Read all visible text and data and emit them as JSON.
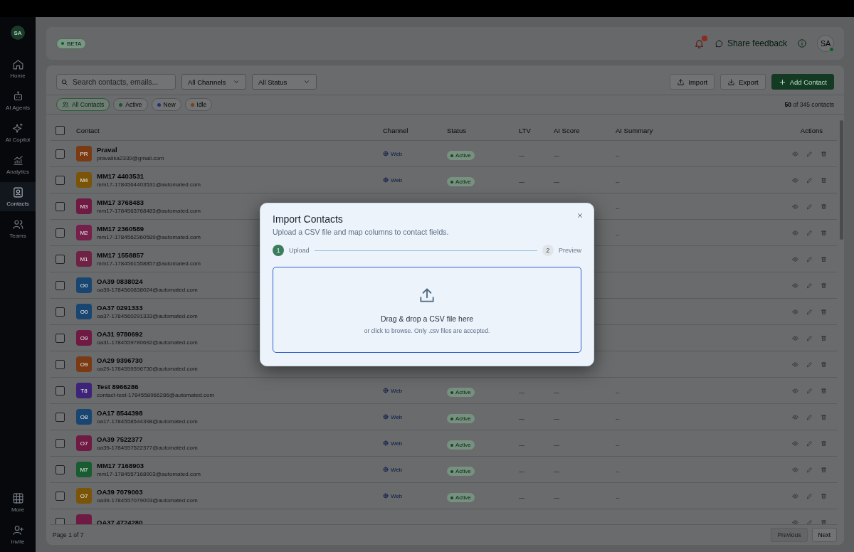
{
  "sidebar": {
    "avatar": "SA",
    "items": [
      {
        "label": "Home",
        "selected": false
      },
      {
        "label": "AI Agents",
        "selected": false
      },
      {
        "label": "AI Copilot",
        "selected": false
      },
      {
        "label": "Analytics",
        "selected": false
      },
      {
        "label": "Contacts",
        "selected": true
      },
      {
        "label": "Teams",
        "selected": false
      }
    ],
    "bottom_items": [
      {
        "label": "More"
      },
      {
        "label": "Invite"
      }
    ]
  },
  "header": {
    "badge": "BETA",
    "feedback": "Share feedback",
    "avatar": "SA"
  },
  "toolbar": {
    "search": {
      "placeholder": "Search contacts, emails..."
    },
    "filters": [
      "All Channels",
      "All Status"
    ],
    "buttons": [
      {
        "label": "Import",
        "kind": "import"
      },
      {
        "label": "Export",
        "kind": "export"
      },
      {
        "label": "Add Contact",
        "kind": "add"
      }
    ]
  },
  "chips": [
    {
      "label": "All Contacts",
      "kind": "all",
      "selected": true
    },
    {
      "label": "Active",
      "kind": "status",
      "color": "#0f5a28",
      "selected": false
    },
    {
      "label": "New",
      "kind": "status",
      "color": "#26307a",
      "selected": false
    },
    {
      "label": "Idle",
      "kind": "status",
      "color": "#7a4212",
      "selected": false
    }
  ],
  "count": "**50** of 345 contacts",
  "table": {
    "columns": [
      "Contact",
      "Channel",
      "Status",
      "LTV",
      "AI Score",
      "AI Summary",
      "Actions"
    ],
    "select_all_checked": false,
    "rows": [
      {
        "initials": "PR",
        "color": "#7a3a14",
        "name": "Praval",
        "email": "pravalika2330@gmail.com",
        "channel": "Web",
        "status": "Active",
        "ltv": "—",
        "score": "—",
        "summary": "--",
        "checked": false
      },
      {
        "initials": "M4",
        "color": "#7a5408",
        "name": "MM17 4403531",
        "email": "mm17-1784564403531@automated.com",
        "channel": "Web",
        "status": "Active",
        "ltv": "—",
        "score": "—",
        "summary": "--",
        "checked": false
      },
      {
        "initials": "M3",
        "color": "#6e1a42",
        "name": "MM17 3768483",
        "email": "mm17-1784563768483@automated.com",
        "summary": "--",
        "checked": false
      },
      {
        "initials": "M2",
        "color": "#74204a",
        "name": "MM17 2360589",
        "email": "mm17-1784562360589@automated.com",
        "summary": "--",
        "checked": false
      },
      {
        "initials": "M1",
        "color": "#6e2244",
        "name": "MM17 1558857",
        "email": "mm17-1784561558857@automated.com",
        "checked": false
      },
      {
        "initials": "O0",
        "color": "#184670",
        "name": "OA39 0838024",
        "email": "oa39-1784560838024@automated.com",
        "checked": false
      },
      {
        "initials": "O0",
        "color": "#184670",
        "name": "OA37 0291333",
        "email": "oa37-1784560291333@automated.com",
        "checked": false
      },
      {
        "initials": "O9",
        "color": "#6e1a42",
        "name": "OA31 9780692",
        "email": "oa31-1784559780692@automated.com",
        "checked": false
      },
      {
        "initials": "O9",
        "color": "#7a3a14",
        "name": "OA29 9396730",
        "email": "oa29-1784559396730@automated.com",
        "checked": false
      },
      {
        "initials": "T8",
        "color": "#3e2478",
        "name": "Test 8966286",
        "email": "contact-test-1784558966286@automated.com",
        "channel": "Web",
        "status": "Active",
        "ltv": "—",
        "score": "—",
        "summary": "--",
        "checked": false
      },
      {
        "initials": "O8",
        "color": "#184670",
        "name": "OA17 8544398",
        "email": "oa17-1784558544398@automated.com",
        "channel": "Web",
        "status": "Active",
        "ltv": "—",
        "score": "—",
        "summary": "--",
        "checked": false
      },
      {
        "initials": "O7",
        "color": "#6e1a42",
        "name": "OA39 7522377",
        "email": "oa39-1784557522377@automated.com",
        "channel": "Web",
        "status": "Active",
        "ltv": "—",
        "score": "—",
        "summary": "--",
        "checked": false
      },
      {
        "initials": "M7",
        "color": "#1a5c32",
        "name": "MM17 7168903",
        "email": "mm17-1784557168903@automated.com",
        "channel": "Web",
        "status": "Active",
        "ltv": "—",
        "score": "—",
        "summary": "--",
        "checked": false
      },
      {
        "initials": "O7",
        "color": "#7a5408",
        "name": "OA39 7079003",
        "email": "oa39-1784557079003@automated.com",
        "channel": "Web",
        "status": "Active",
        "ltv": "—",
        "score": "—",
        "summary": "--",
        "checked": false
      },
      {
        "color": "#6e1a42",
        "name": "OA37 4724280",
        "checked": false
      }
    ]
  },
  "pagination": {
    "label": "Page 1 of 7",
    "buttons": [
      {
        "label": "Previous",
        "disabled": true
      },
      {
        "label": "Next",
        "disabled": false
      }
    ]
  },
  "modal": {
    "title": "Import Contacts",
    "subtitle": "Upload a CSV file and map columns to contact fields.",
    "steps": [
      {
        "number": "1",
        "label": "Upload",
        "selected": true
      },
      {
        "number": "2",
        "label": "Preview",
        "selected": false
      }
    ],
    "drop_title": "Drag & drop a CSV file here",
    "drop_hint": "or click to browse. Only .csv files are accepted."
  }
}
